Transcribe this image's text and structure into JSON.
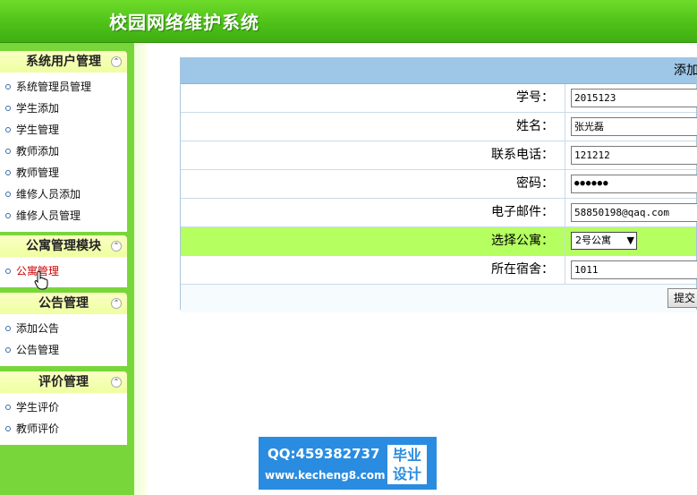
{
  "header": {
    "title": "校园网络维护系统"
  },
  "sidebar": {
    "panels": [
      {
        "title": "系统用户管理",
        "items": [
          "系统管理员管理",
          "学生添加",
          "学生管理",
          "教师添加",
          "教师管理",
          "维修人员添加",
          "维修人员管理"
        ]
      },
      {
        "title": "公寓管理模块",
        "items": [
          "公寓管理"
        ]
      },
      {
        "title": "公告管理",
        "items": [
          "添加公告",
          "公告管理"
        ]
      },
      {
        "title": "评价管理",
        "items": [
          "学生评价",
          "教师评价"
        ]
      }
    ],
    "collapse_glyph": "⌃"
  },
  "form": {
    "title": "添加",
    "fields": {
      "student_id": {
        "label": "学号：",
        "value": "2015123"
      },
      "name": {
        "label": "姓名：",
        "value": "张光磊"
      },
      "phone": {
        "label": "联系电话：",
        "value": "121212"
      },
      "password": {
        "label": "密码：",
        "value": "●●●●●●"
      },
      "email": {
        "label": "电子邮件：",
        "value": "58850198@qaq.com"
      },
      "apartment": {
        "label": "选择公寓：",
        "value": "2号公寓"
      },
      "dorm": {
        "label": "所在宿舍：",
        "value": "1011"
      }
    },
    "submit_label": "提交"
  },
  "badge": {
    "qq": "QQ:459382737",
    "url": "www.kecheng8.com",
    "tag_line1": "毕业",
    "tag_line2": "设计"
  }
}
